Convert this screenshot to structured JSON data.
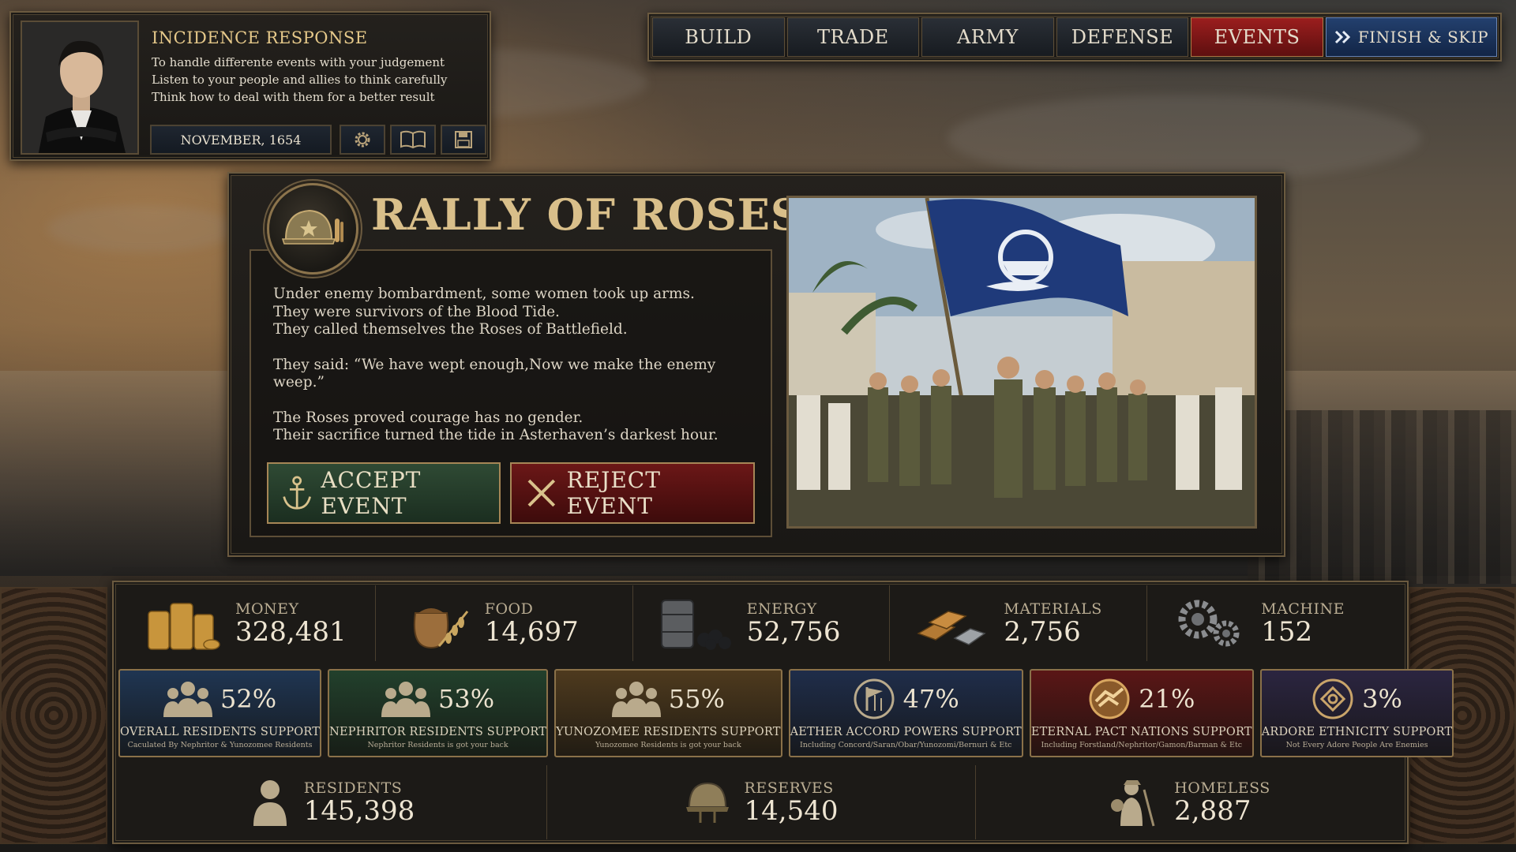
{
  "advisor": {
    "title": "INCIDENCE RESPONSE",
    "lines": [
      "To handle differente events with your judgement",
      "Listen to your people and allies to think carefully",
      "Think how to deal with them for a better result"
    ],
    "date": "NOVEMBER, 1654",
    "buttons": [
      "gear-icon",
      "book-icon",
      "save-icon"
    ]
  },
  "nav": {
    "tabs": [
      "BUILD",
      "TRADE",
      "ARMY",
      "DEFENSE",
      "EVENTS"
    ],
    "active": "EVENTS",
    "finish_label": "FINISH & SKIP"
  },
  "event": {
    "title": "RALLY OF ROSES",
    "body": [
      "Under enemy bombardment, some women took up arms.",
      "They were survivors of the Blood Tide.",
      "They called themselves the Roses of Battlefield.",
      "",
      "They said: “We have wept enough,Now we make the enemy weep.”",
      "",
      "The Roses proved courage has no gender.",
      "Their sacrifice turned the tide in Asterhaven’s darkest hour."
    ],
    "accept_label": "ACCEPT EVENT",
    "reject_label": "REJECT EVENT"
  },
  "resources": [
    {
      "label": "MONEY",
      "value": "328,481",
      "icon": "coins-icon"
    },
    {
      "label": "FOOD",
      "value": "14,697",
      "icon": "food-sack-icon"
    },
    {
      "label": "ENERGY",
      "value": "52,756",
      "icon": "oil-barrel-icon"
    },
    {
      "label": "MATERIALS",
      "value": "2,756",
      "icon": "ingots-icon"
    },
    {
      "label": "MACHINE",
      "value": "152",
      "icon": "gears-icon"
    }
  ],
  "support": [
    {
      "pct": "52%",
      "label": "OVERALL RESIDENTS SUPPORT",
      "sub": "Caculated By Nephritor & Yunozomee Residents",
      "color": "#1f3552"
    },
    {
      "pct": "53%",
      "label": "NEPHRITOR RESIDENTS SUPPORT",
      "sub": "Nephritor Residents is got your back",
      "color": "#22402c"
    },
    {
      "pct": "55%",
      "label": "YUNOZOMEE RESIDENTS SUPPORT",
      "sub": "Yunozomee Residents is got your back",
      "color": "#4e3a1e"
    },
    {
      "pct": "47%",
      "label": "AETHER ACCORD POWERS SUPPORT",
      "sub": "Including Concord/Saran/Obar/Yunozomi/Bernuri & Etc",
      "color": "#1f2d4a"
    },
    {
      "pct": "21%",
      "label": "ETERNAL PACT NATIONS SUPPORT",
      "sub": "Including Forstland/Nephritor/Gamon/Barman & Etc",
      "color": "#5a1616"
    },
    {
      "pct": "3%",
      "label": "ARDORE  ETHNICITY SUPPORT",
      "sub": "Not Every Adore People Are Enemies",
      "color": "#2b2540"
    }
  ],
  "population": [
    {
      "label": "RESIDENTS",
      "value": "145,398",
      "icon": "person-icon"
    },
    {
      "label": "RESERVES",
      "value": "14,540",
      "icon": "helmet-icon"
    },
    {
      "label": "HOMELESS",
      "value": "2,887",
      "icon": "wanderer-icon"
    }
  ],
  "colors": {
    "accent_gold": "#d9bf8a",
    "events_red": "#9b1e1e",
    "finish_blue": "#23406e"
  }
}
